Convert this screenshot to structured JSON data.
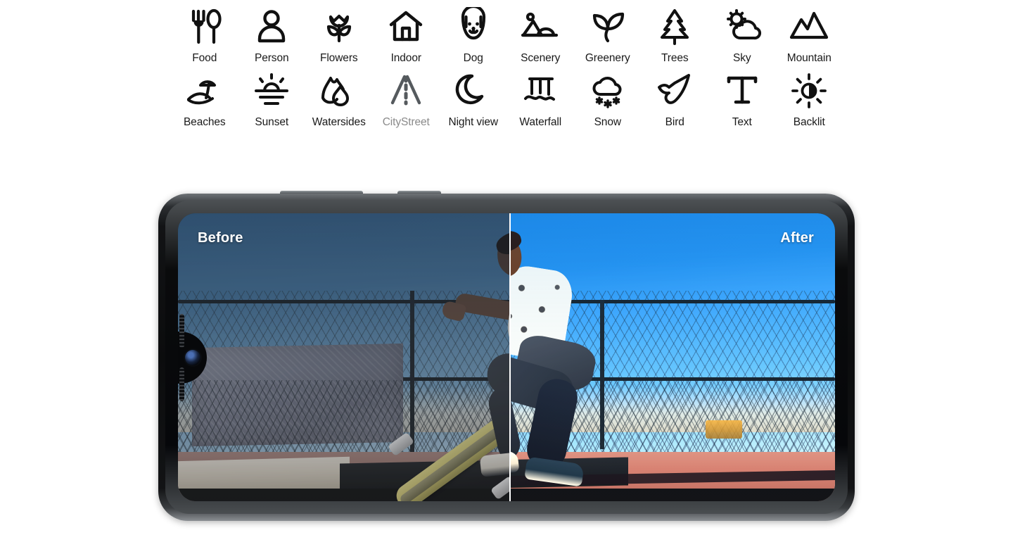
{
  "scene_optimizer": {
    "rows": [
      [
        {
          "label": "Food",
          "icon": "food-icon",
          "dim": false
        },
        {
          "label": "Person",
          "icon": "person-icon",
          "dim": false
        },
        {
          "label": "Flowers",
          "icon": "flowers-icon",
          "dim": false
        },
        {
          "label": "Indoor",
          "icon": "indoor-icon",
          "dim": false
        },
        {
          "label": "Dog",
          "icon": "dog-icon",
          "dim": false
        },
        {
          "label": "Scenery",
          "icon": "scenery-icon",
          "dim": false
        },
        {
          "label": "Greenery",
          "icon": "greenery-icon",
          "dim": false
        },
        {
          "label": "Trees",
          "icon": "trees-icon",
          "dim": false
        },
        {
          "label": "Sky",
          "icon": "sky-icon",
          "dim": false
        },
        {
          "label": "Mountain",
          "icon": "mountain-icon",
          "dim": false
        }
      ],
      [
        {
          "label": "Beaches",
          "icon": "beaches-icon",
          "dim": false
        },
        {
          "label": "Sunset",
          "icon": "sunset-icon",
          "dim": false
        },
        {
          "label": "Watersides",
          "icon": "watersides-icon",
          "dim": false
        },
        {
          "label": "CityStreet",
          "icon": "citystreet-icon",
          "dim": true
        },
        {
          "label": "Night view",
          "icon": "night-view-icon",
          "dim": false
        },
        {
          "label": "Waterfall",
          "icon": "waterfall-icon",
          "dim": false
        },
        {
          "label": "Snow",
          "icon": "snow-icon",
          "dim": false
        },
        {
          "label": "Bird",
          "icon": "bird-icon",
          "dim": false
        },
        {
          "label": "Text",
          "icon": "text-icon",
          "dim": false
        },
        {
          "label": "Backlit",
          "icon": "backlit-icon",
          "dim": false
        }
      ]
    ],
    "colors": {
      "icon": "#111111",
      "label": "#1a1a1a",
      "dim": "#8a8a8a",
      "background": "#ffffff"
    }
  },
  "device": {
    "name": "smartphone-landscape",
    "frame_color": "#0b0c0d",
    "buttons": [
      "volume-rocker",
      "power-button"
    ],
    "front_camera": "punch-hole-notch"
  },
  "comparison": {
    "before_label": "Before",
    "after_label": "After",
    "divider_color": "#ffffff",
    "subject": "skateboarder mid-air trick at outdoor court",
    "before_tone": "#3b6f9e",
    "after_tone": "#4a9ede"
  }
}
